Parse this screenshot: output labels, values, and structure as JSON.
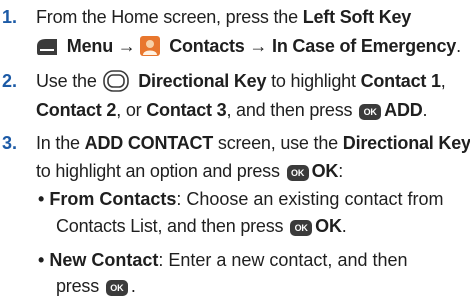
{
  "steps": [
    {
      "number": "1.",
      "l1_a": "From the Home screen, press the ",
      "l1_b": "Left Soft Key",
      "l2_a": " Menu → ",
      "l2_b": " Contacts → In Case of Emergency",
      "l2_c": "."
    },
    {
      "number": "2.",
      "l1_a": "Use the ",
      "l1_b": " Directional Key",
      "l1_c": " to highlight ",
      "l1_d": "Contact 1",
      "l1_e": ",",
      "l2_a": "Contact 2",
      "l2_b": ", or ",
      "l2_c": "Contact 3",
      "l2_d": ", and then press ",
      "l2_e": "ADD",
      "l2_f": "."
    },
    {
      "number": "3.",
      "l1_a": "In the ",
      "l1_b": "ADD CONTACT",
      "l1_c": " screen, use the ",
      "l1_d": "Directional Key",
      "l2_a": "to highlight an option and press ",
      "l2_b": "OK",
      "l2_c": ":"
    }
  ],
  "bullets": [
    {
      "marker": "•",
      "title": "From Contacts",
      "l1_rest": ": Choose an existing contact from",
      "l2_a": "Contacts List, and then press ",
      "l2_b": "OK",
      "l2_c": "."
    },
    {
      "marker": "•",
      "title": "New Contact",
      "l1_rest": ": Enter a new contact, and then",
      "l2_a": "press ",
      "l2_c": "."
    }
  ],
  "ok_key_label": "OK",
  "icons": {
    "soft_key": "left-soft-key-icon",
    "contacts": "contacts-app-icon",
    "directional": "directional-key-icon",
    "ok": "ok-key-icon"
  },
  "colors": {
    "step_number": "#1c5aa6",
    "text": "#1f1f1f",
    "ok_key_bg": "#3b3b3b",
    "contacts_icon": "#e8772e"
  }
}
